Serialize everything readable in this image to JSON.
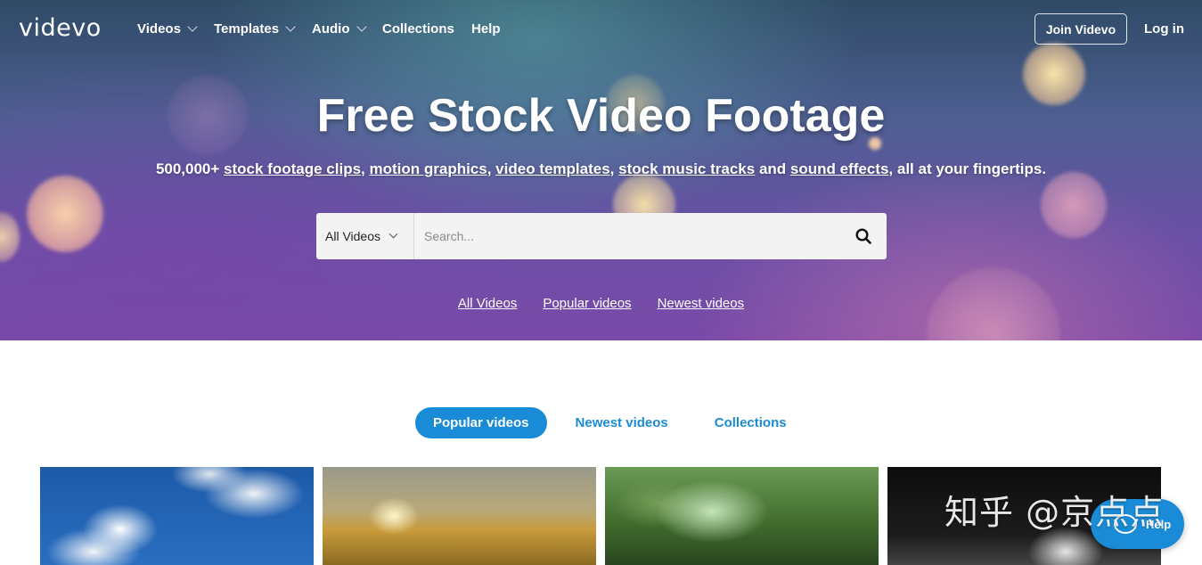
{
  "brand": {
    "logo": "videvo"
  },
  "nav": {
    "items": [
      {
        "label": "Videos",
        "has_dropdown": true
      },
      {
        "label": "Templates",
        "has_dropdown": true
      },
      {
        "label": "Audio",
        "has_dropdown": true
      },
      {
        "label": "Collections",
        "has_dropdown": false
      },
      {
        "label": "Help",
        "has_dropdown": false
      }
    ],
    "join_label": "Join Videvo",
    "login_label": "Log in"
  },
  "hero": {
    "title": "Free Stock Video Footage",
    "subtitle": {
      "prefix": "500,000+ ",
      "links": [
        "stock footage clips",
        "motion graphics",
        "video templates",
        "stock music tracks",
        "sound effects"
      ],
      "and": " and ",
      "suffix": ", all at your fingertips."
    },
    "search": {
      "type_label": "All Videos",
      "placeholder": "Search...",
      "value": ""
    },
    "quick_links": [
      "All Videos",
      "Popular videos",
      "Newest videos"
    ]
  },
  "tabs": {
    "items": [
      "Popular videos",
      "Newest videos",
      "Collections"
    ],
    "active": "Popular videos"
  },
  "thumbnails": [
    {
      "subject": "sky-clouds"
    },
    {
      "subject": "hand-wheat-field"
    },
    {
      "subject": "forest"
    },
    {
      "subject": "cave-mountain"
    }
  ],
  "help_button": {
    "label": "Help"
  },
  "watermark": {
    "text": "知乎 @京点点"
  },
  "colors": {
    "accent": "#1a8bd6",
    "text_light": "#ffffff"
  }
}
